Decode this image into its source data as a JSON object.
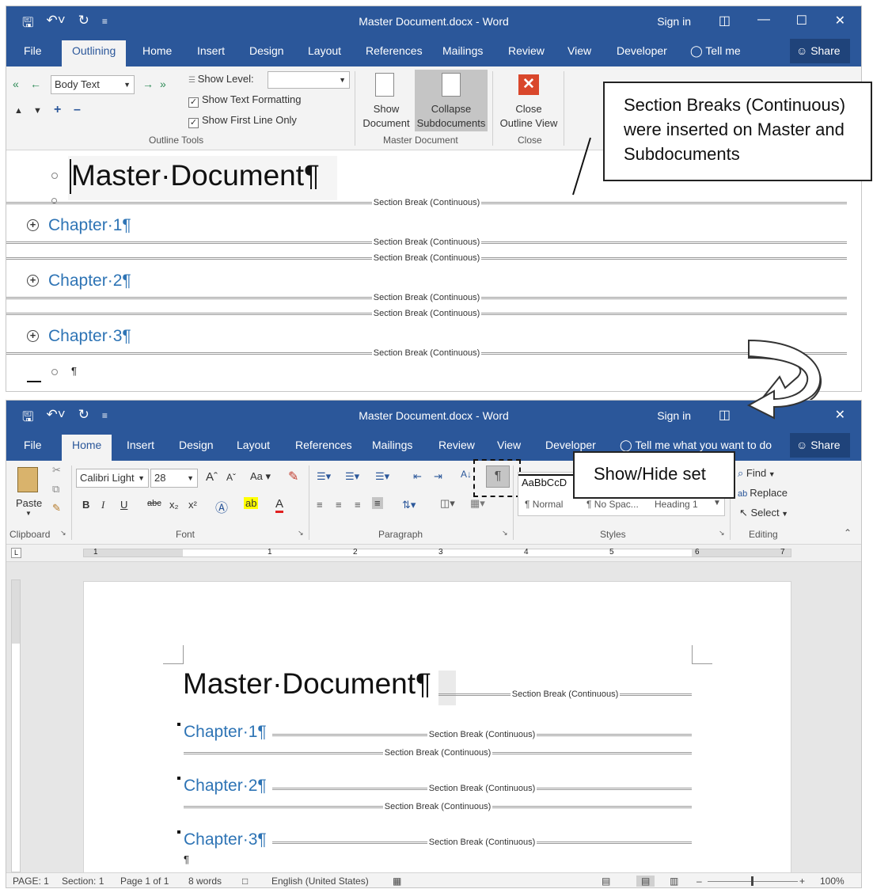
{
  "top_window": {
    "title": "Master Document.docx  -  Word",
    "sign_in": "Sign in",
    "share": "Share",
    "tabs": [
      "File",
      "Outlining",
      "Home",
      "Insert",
      "Design",
      "Layout",
      "References",
      "Mailings",
      "Review",
      "View",
      "Developer"
    ],
    "tell_me": "Tell me",
    "outline_tools": {
      "level_value": "Body Text",
      "show_level_label": "Show Level:",
      "show_text_formatting": "Show Text Formatting",
      "show_first_line_only": "Show First Line Only",
      "group_label": "Outline Tools"
    },
    "master_document": {
      "show_document_l1": "Show",
      "show_document_l2": "Document",
      "collapse_l1": "Collapse",
      "collapse_l2": "Subdocuments",
      "group_label": "Master Document"
    },
    "close_group": {
      "close_l1": "Close",
      "close_l2": "Outline View",
      "group_label": "Close"
    },
    "outline": {
      "title": "Master·Document¶",
      "chapters": [
        "Chapter·1¶",
        "Chapter·2¶",
        "Chapter·3¶"
      ],
      "section_break": "Section Break (Continuous)",
      "empty_para": "¶"
    }
  },
  "callout_section": {
    "line1": "Section Breaks (Continuous)",
    "line2": "were inserted on Master and",
    "line3": "Subdocuments"
  },
  "callout_showhide": "Show/Hide set",
  "bottom_window": {
    "title": "Master Document.docx  -  Word",
    "sign_in": "Sign in",
    "share": "Share",
    "tabs": [
      "File",
      "Home",
      "Insert",
      "Design",
      "Layout",
      "References",
      "Mailings",
      "Review",
      "View",
      "Developer"
    ],
    "tell_me": "Tell me what you want to do",
    "clipboard": {
      "paste": "Paste",
      "group_label": "Clipboard"
    },
    "font": {
      "name": "Calibri Light",
      "size": "28",
      "group_label": "Font",
      "buttons": [
        "B",
        "I",
        "U",
        "abc",
        "x₂",
        "x²"
      ]
    },
    "paragraph": {
      "group_label": "Paragraph",
      "pilcrow": "¶"
    },
    "styles": {
      "preview": "AaBbCcD",
      "items": [
        "¶ Normal",
        "¶ No Spac...",
        "Heading 1"
      ],
      "group_label": "Styles"
    },
    "editing": {
      "find": "Find",
      "replace": "Replace",
      "select": "Select",
      "group_label": "Editing"
    },
    "ruler_numbers": [
      "1",
      "1",
      "2",
      "3",
      "4",
      "5",
      "6",
      "7"
    ],
    "document": {
      "title": "Master·Document¶",
      "chapters": [
        "Chapter·1¶",
        "Chapter·2¶",
        "Chapter·3¶"
      ],
      "section_break": "Section Break (Continuous)",
      "empty_para": "¶"
    },
    "status": {
      "page": "PAGE: 1",
      "section": "Section: 1",
      "page_of": "Page 1 of 1",
      "words": "8 words",
      "language": "English (United States)",
      "zoom": "100%"
    }
  },
  "colors": {
    "word_blue": "#2b579a",
    "heading_blue": "#2e74b5",
    "close_red": "#d9472b"
  }
}
